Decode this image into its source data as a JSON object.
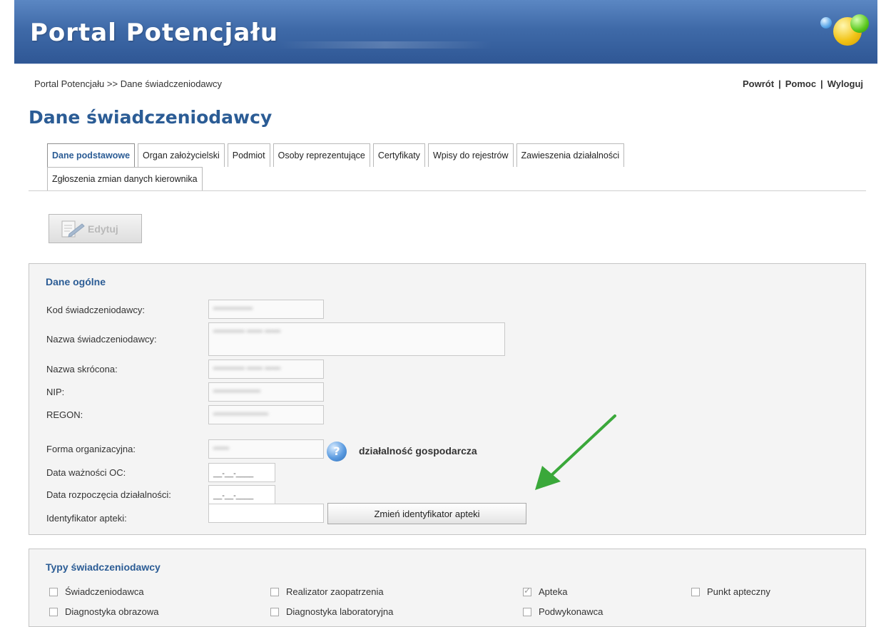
{
  "header": {
    "title": "Portal Potencjału"
  },
  "breadcrumb": "Portal Potencjału >> Dane świadczeniodawcy",
  "top_links": {
    "back": "Powrót",
    "help": "Pomoc",
    "logout": "Wyloguj",
    "separator": "|"
  },
  "page_title": "Dane świadczeniodawcy",
  "tabs": {
    "row1": [
      "Dane podstawowe",
      "Organ założycielski",
      "Podmiot",
      "Osoby reprezentujące",
      "Certyfikaty",
      "Wpisy do rejestrów",
      "Zawieszenia działalności"
    ],
    "row2": [
      "Zgłoszenia zmian danych kierownika"
    ],
    "active": "Dane podstawowe"
  },
  "edit_button": {
    "label": "Edytuj",
    "enabled": false
  },
  "general": {
    "title": "Dane ogólne",
    "fields": {
      "kod": {
        "label": "Kod świadczeniodawcy:"
      },
      "nazwa": {
        "label": "Nazwa świadczeniodawcy:"
      },
      "nazwa_skrocona": {
        "label": "Nazwa skrócona:"
      },
      "nip": {
        "label": "NIP:"
      },
      "regon": {
        "label": "REGON:"
      },
      "forma": {
        "label": "Forma organizacyjna:",
        "description": "działalność gospodarcza"
      },
      "data_oc": {
        "label": "Data ważności OC:",
        "value": "__-__-____"
      },
      "data_rozpoczecia": {
        "label": "Data rozpoczęcia działalności:",
        "value": "__-__-____"
      },
      "identyfikator": {
        "label": "Identyfikator apteki:",
        "value": ""
      }
    },
    "change_button": "Zmień identyfikator apteki"
  },
  "types": {
    "title": "Typy świadczeniodawcy",
    "items": [
      {
        "label": "Świadczeniodawca",
        "checked": false
      },
      {
        "label": "Realizator zaopatrzenia",
        "checked": false
      },
      {
        "label": "Apteka",
        "checked": true
      },
      {
        "label": "Punkt apteczny",
        "checked": false
      },
      {
        "label": "Diagnostyka obrazowa",
        "checked": false
      },
      {
        "label": "Diagnostyka laboratoryjna",
        "checked": false
      },
      {
        "label": "Podwykonawca",
        "checked": false
      }
    ]
  },
  "colors": {
    "accent": "#2b5c95",
    "header": "#3f6aa8",
    "annotation_arrow": "#3aa83a"
  }
}
